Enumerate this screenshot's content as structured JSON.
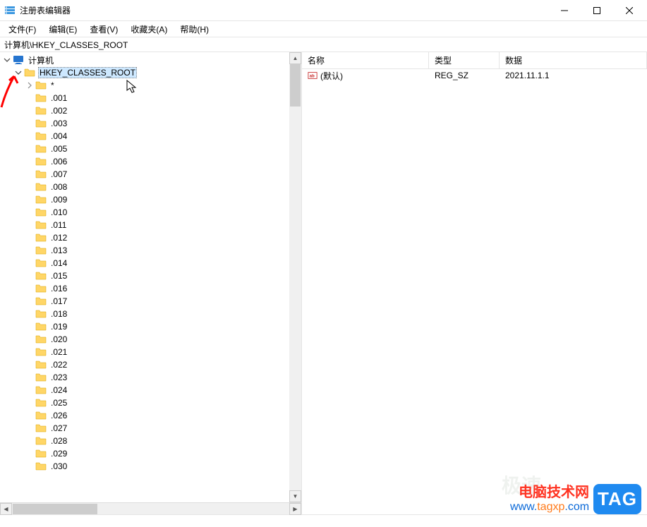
{
  "window": {
    "title": "注册表编辑器"
  },
  "menu": {
    "file": "文件(F)",
    "edit": "编辑(E)",
    "view": "查看(V)",
    "favorites": "收藏夹(A)",
    "help": "帮助(H)"
  },
  "address": "计算机\\HKEY_CLASSES_ROOT",
  "tree": {
    "root": "计算机",
    "selected": "HKEY_CLASSES_ROOT",
    "star": "*",
    "items": [
      ".001",
      ".002",
      ".003",
      ".004",
      ".005",
      ".006",
      ".007",
      ".008",
      ".009",
      ".010",
      ".011",
      ".012",
      ".013",
      ".014",
      ".015",
      ".016",
      ".017",
      ".018",
      ".019",
      ".020",
      ".021",
      ".022",
      ".023",
      ".024",
      ".025",
      ".026",
      ".027",
      ".028",
      ".029",
      ".030"
    ]
  },
  "list": {
    "columns": {
      "name": "名称",
      "type": "类型",
      "data": "数据"
    },
    "rows": [
      {
        "name": "(默认)",
        "type": "REG_SZ",
        "data": "2021.11.1.1"
      }
    ]
  },
  "watermark": {
    "cn": "电脑技术网",
    "url_prefix": "www.",
    "url_mid": "tagxp",
    "url_suffix": ".com",
    "tag": "TAG"
  }
}
